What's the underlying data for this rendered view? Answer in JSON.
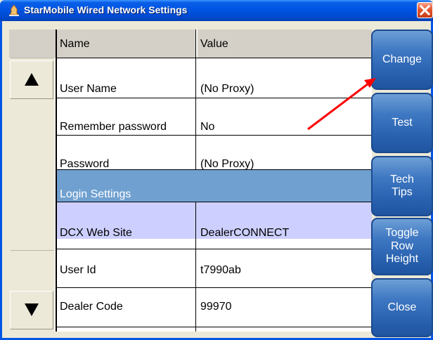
{
  "window": {
    "title": "StarMobile Wired Network Settings"
  },
  "table": {
    "columns": [
      "Name",
      "Value"
    ],
    "rows": [
      {
        "name": "User Name",
        "value": "(No Proxy)"
      },
      {
        "name": "Remember password",
        "value": "No"
      },
      {
        "name": "Password",
        "value": "(No Proxy)"
      },
      {
        "name": "Login Settings",
        "value": ""
      },
      {
        "name": "DCX Web Site",
        "value": "DealerCONNECT"
      },
      {
        "name": "User Id",
        "value": "t7990ab"
      },
      {
        "name": "Dealer Code",
        "value": "99970"
      }
    ],
    "section_row_color": "#6fa0d0",
    "selected_row_color": "#cdd0ff"
  },
  "side_buttons": {
    "change": "Change",
    "test": "Test",
    "tech_tips": "Tech\nTips",
    "toggle_row_height": "Toggle\nRow\nHeight",
    "close": "Close"
  },
  "icons": {
    "app": "app-flame-icon",
    "close": "close-x-icon",
    "scroll_up": "triangle-up-icon",
    "scroll_down": "triangle-down-icon",
    "annotation": "red-arrow-annotation"
  }
}
